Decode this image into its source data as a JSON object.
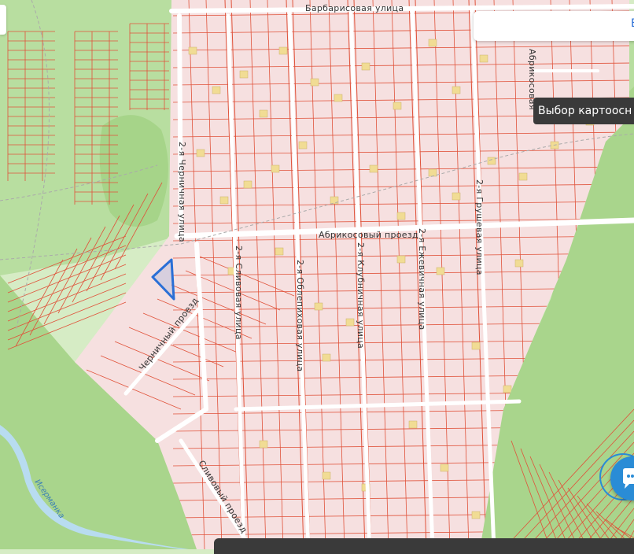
{
  "map": {
    "streets": [
      {
        "id": "barbarisovaya",
        "label": "Барбарисовая улица"
      },
      {
        "id": "abrikosovy-proezd",
        "label": "Абрикосовый проезд"
      },
      {
        "id": "abrikosovaya",
        "label": "Абрикосовая"
      },
      {
        "id": "chernichnaya-2",
        "label": "2-я Черничная улица"
      },
      {
        "id": "slivovaya-2",
        "label": "2-я Сливовая улица"
      },
      {
        "id": "oblepikhovaya-2",
        "label": "2-я Облепиховая улица"
      },
      {
        "id": "klubnichnaya-2",
        "label": "2-я Клубничная улица"
      },
      {
        "id": "ezhevichnaya-2",
        "label": "2-я Ежевичная улица"
      },
      {
        "id": "grushevaya-2",
        "label": "2-я Грушевая улица"
      },
      {
        "id": "chernichny-proezd",
        "label": "Черничный проезд"
      },
      {
        "id": "slivovy-proezd",
        "label": "Сливовый проезд"
      }
    ],
    "river_label": "Исерманка",
    "colors": {
      "background_green": "#d6ecc5",
      "forest_green": "#a9d58c",
      "plot_fill": "#f6e0e0",
      "plot_border": "#e0523a",
      "road": "#ffffff",
      "building": "#f1dc94",
      "river": "#b8dcf0",
      "selection": "#2a6fd6"
    }
  },
  "search": {
    "partial_text": "Е"
  },
  "tooltip": {
    "text": "Выбор картоосн"
  },
  "chat_button": {
    "icon": "chat-bubble-icon"
  },
  "bottom_bar": {
    "text": ""
  }
}
